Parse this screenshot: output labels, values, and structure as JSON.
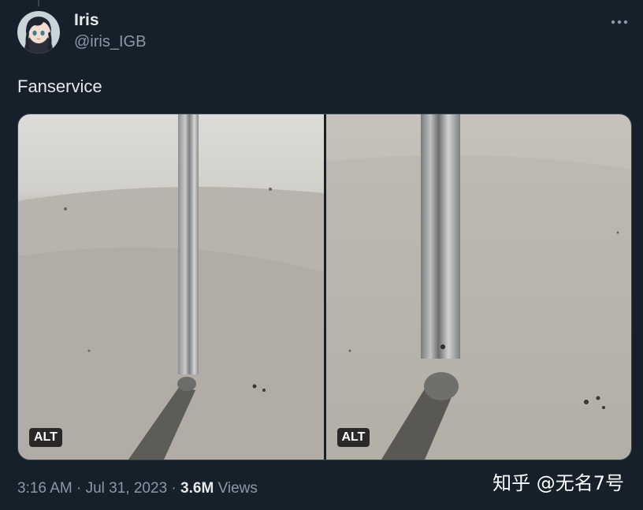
{
  "tweet": {
    "author": {
      "display_name": "Iris",
      "handle": "@iris_IGB",
      "avatar_icon": "anime-avatar"
    },
    "more_icon": "more-horizontal-icon",
    "text": "Fanservice",
    "media": [
      {
        "alt_badge": "ALT"
      },
      {
        "alt_badge": "ALT"
      }
    ],
    "meta": {
      "time": "3:16 AM",
      "separator": "·",
      "date": "Jul 31, 2023",
      "views_count": "3.6M",
      "views_label": "Views"
    }
  },
  "watermark": "知乎 @无名7号",
  "colors": {
    "background": "#15202b",
    "text_primary": "#e7e9ea",
    "text_secondary": "#8b98a5",
    "border": "#38444d"
  }
}
